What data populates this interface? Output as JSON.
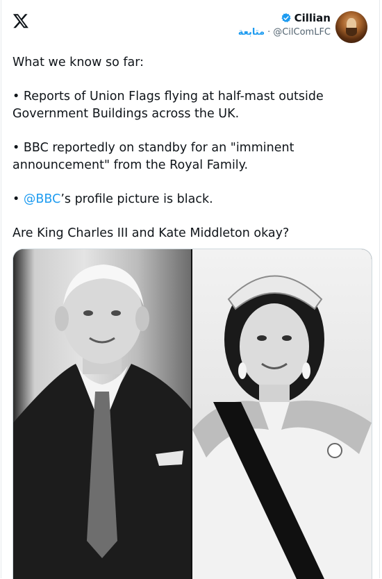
{
  "header": {
    "display_name": "Cillian",
    "handle": "@CilComLFC",
    "separator": "·",
    "follow_label": "متابعة"
  },
  "tweet": {
    "intro": "What we know so far:",
    "bullet1": "• Reports of Union Flags flying at half-mast outside Government Buildings across the UK.",
    "bullet2": "• BBC reportedly on standby for an \"imminent announcement\" from the Royal Family.",
    "bullet3_prefix": "• ",
    "bullet3_mention": "@BBC",
    "bullet3_suffix": "’s profile picture is black.",
    "question": "Are King Charles III and Kate Middleton okay?"
  },
  "colors": {
    "accent": "#1d9bf0",
    "text": "#0f1419",
    "muted": "#536471"
  },
  "icons": {
    "logo": "x-logo-icon",
    "verified": "verified-badge-icon"
  }
}
